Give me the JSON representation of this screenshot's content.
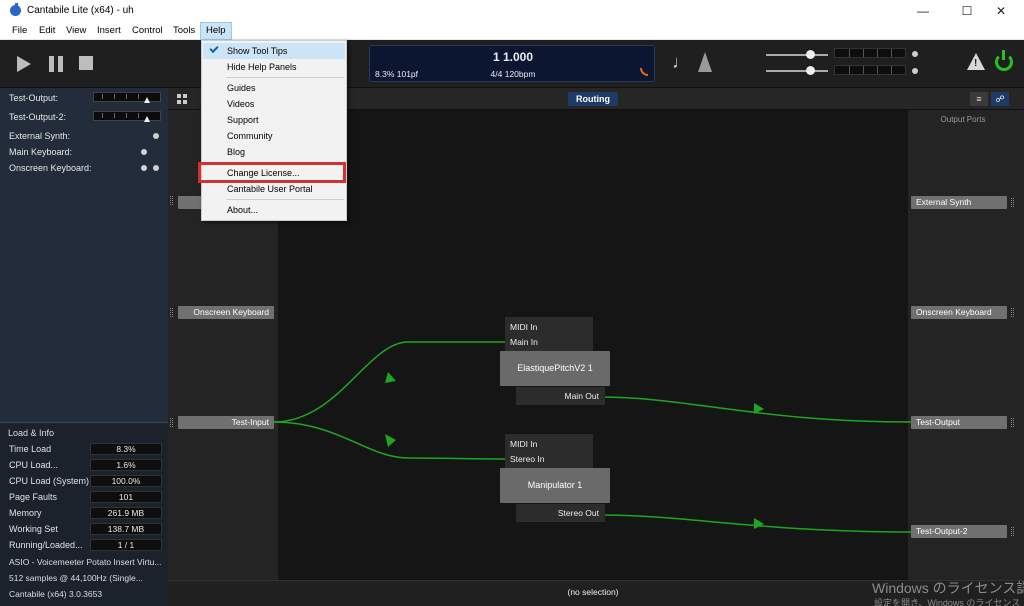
{
  "window": {
    "title": "Cantabile Lite (x64) - uh",
    "minimize": "—",
    "maximize": "☐",
    "close": "✕"
  },
  "menubar": [
    "File",
    "Edit",
    "View",
    "Insert",
    "Control",
    "Tools",
    "Help"
  ],
  "help_menu": {
    "items": [
      "Show Tool Tips",
      "Hide Help Panels",
      "Guides",
      "Videos",
      "Support",
      "Community",
      "Blog",
      "Change License...",
      "Cantabile User Portal",
      "About..."
    ],
    "checked_item": "Show Tool Tips",
    "highlighted_item": "Change License...",
    "highlight_color": "#d62f2f"
  },
  "transport": {
    "position": "1 1.000",
    "load": "8.3%  101pf",
    "tempo": "4/4 120bpm"
  },
  "left_panel": {
    "ports": [
      "Test-Output:",
      "Test-Output-2:",
      "External Synth:",
      "Main Keyboard:",
      "Onscreen Keyboard:"
    ],
    "load_info": {
      "title": "Load & Info",
      "rows": [
        {
          "label": "Time Load",
          "value": "8.3%"
        },
        {
          "label": "CPU Load...",
          "value": "1.6%"
        },
        {
          "label": "CPU Load (System)",
          "value": "100.0%"
        },
        {
          "label": "Page Faults",
          "value": "101"
        },
        {
          "label": "Memory",
          "value": "261.9 MB"
        },
        {
          "label": "Working Set",
          "value": "138.7 MB"
        },
        {
          "label": "Running/Loaded...",
          "value": "1 / 1"
        }
      ],
      "lines": [
        "ASIO - Voicemeeter Potato Insert Virtu...",
        "512 samples @ 44,100Hz (Single...",
        "Cantabile (x64) 3.0.3653"
      ]
    }
  },
  "view": {
    "tab": "Routing",
    "output_ports_header": "Output Ports"
  },
  "routing": {
    "input_ports": [
      "Onscreen Keyboard",
      "Test-Input"
    ],
    "output_ports": [
      "External Synth",
      "Onscreen Keyboard",
      "Test-Output",
      "Test-Output-2"
    ],
    "plugins": [
      {
        "name": "ElastiquePitchV2 1",
        "inputs": [
          "MIDI In",
          "Main In"
        ],
        "output": "Main Out"
      },
      {
        "name": "Manipulator 1",
        "inputs": [
          "MIDI In",
          "Stereo In"
        ],
        "output": "Stereo Out"
      }
    ],
    "wire_color": "#1fa61f"
  },
  "status": {
    "selection": "(no selection)"
  },
  "watermark": {
    "line1": "Windows のライセンス認",
    "line2": "設定を開き、Windows のライセンス"
  },
  "icons": [
    "app-icon",
    "play-icon",
    "pause-icon",
    "stop-icon",
    "note-icon",
    "metronome-icon",
    "rss-icon",
    "warning-icon",
    "power-icon",
    "grid-icon",
    "list-icon",
    "share-icon",
    "check-icon"
  ]
}
